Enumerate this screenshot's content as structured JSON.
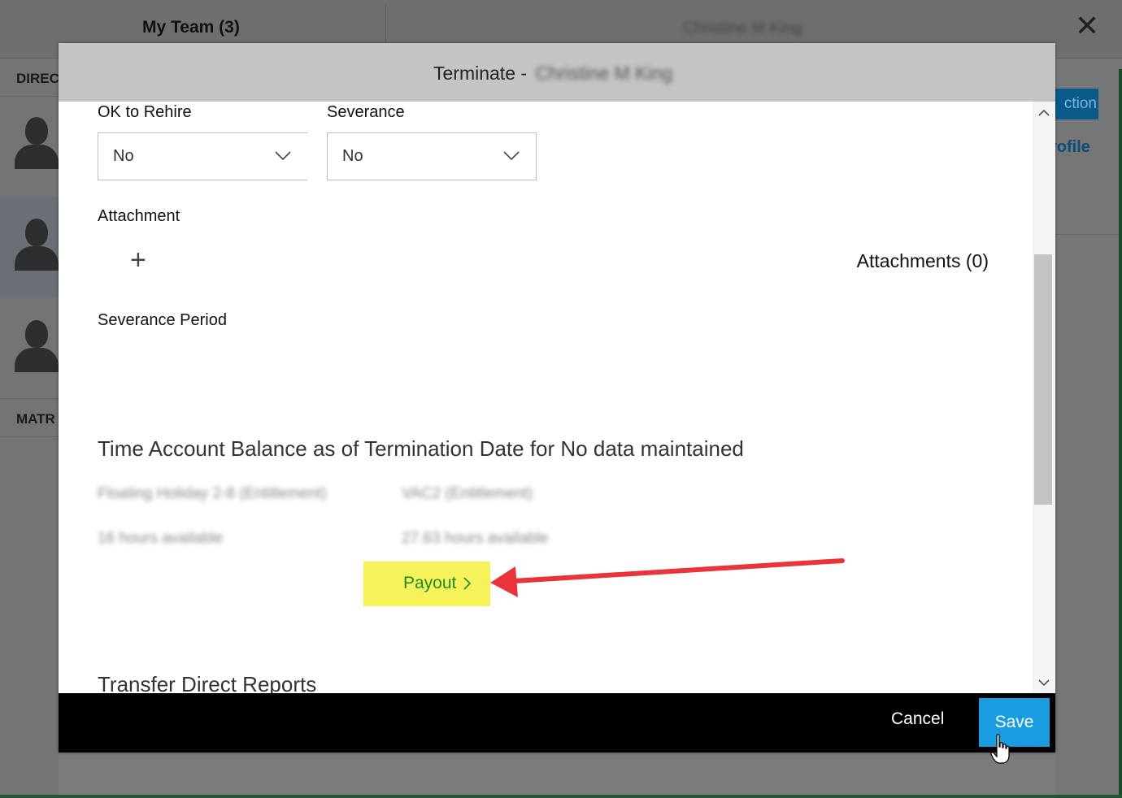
{
  "background": {
    "team_title": "My Team (3)",
    "employee_name": "Christine M King",
    "close_glyph": "✕",
    "section_direct": "DIREC",
    "section_matrix": "MATR",
    "action_button": "ction",
    "profile_link": "rofile"
  },
  "modal": {
    "title_prefix": "Terminate -",
    "title_name": "Christine M King",
    "ok_to_rehire": {
      "label": "OK to Rehire",
      "value": "No"
    },
    "severance": {
      "label": "Severance",
      "value": "No"
    },
    "attachment": {
      "label": "Attachment",
      "add_glyph": "+",
      "count_text": "Attachments (0)"
    },
    "severance_period_label": "Severance Period",
    "time_account": {
      "heading": "Time Account Balance as of Termination Date for No data maintained",
      "accounts": [
        {
          "name": "Floating Holiday 2-8 (Entitlement)",
          "balance": "16 hours available"
        },
        {
          "name": "VAC2 (Entitlement)",
          "balance": "27.63 hours available"
        }
      ],
      "payout_label": "Payout"
    },
    "transfer_heading": "Transfer Direct Reports",
    "footer": {
      "cancel_label": "Cancel",
      "save_label": "Save"
    }
  },
  "colors": {
    "header_bg": "#c2c5c4",
    "footer_bg": "#000000",
    "save_bg": "#1a9de0",
    "payout_highlight": "#f5f25a",
    "payout_text": "#1f8a2a",
    "annotation_arrow": "#e8343a"
  },
  "icons": {
    "dropdown": "chevron-down-icon",
    "payout": "chevron-right-icon",
    "scroll_up": "chevron-up-icon",
    "scroll_down": "chevron-down-icon",
    "cursor": "hand-pointer-icon"
  }
}
